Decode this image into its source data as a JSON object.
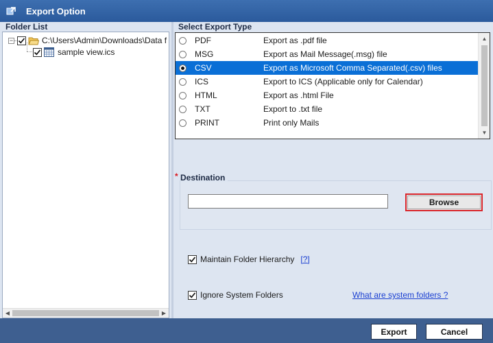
{
  "window": {
    "title": "Export Option"
  },
  "folder_list": {
    "heading": "Folder List",
    "root": {
      "label": "C:\\Users\\Admin\\Downloads\\Data f",
      "checked": true,
      "expander": "−"
    },
    "child": {
      "label": "sample view.ics",
      "checked": true
    }
  },
  "export_type": {
    "heading": "Select Export Type",
    "options": [
      {
        "code": "PDF",
        "desc": "Export as .pdf file",
        "selected": false
      },
      {
        "code": "MSG",
        "desc": "Export as Mail Message(.msg) file",
        "selected": false
      },
      {
        "code": "CSV",
        "desc": "Export as Microsoft Comma Separated(.csv) files",
        "selected": true
      },
      {
        "code": "ICS",
        "desc": "Export to ICS (Applicable only for Calendar)",
        "selected": false
      },
      {
        "code": "HTML",
        "desc": "Export as .html File",
        "selected": false
      },
      {
        "code": "TXT",
        "desc": "Export to .txt file",
        "selected": false
      },
      {
        "code": "PRINT",
        "desc": "Print only Mails",
        "selected": false
      }
    ]
  },
  "destination": {
    "required_mark": "*",
    "label": "Destination",
    "value": "",
    "browse_label": "Browse"
  },
  "options": {
    "maintain_hierarchy": {
      "label": "Maintain Folder Hierarchy",
      "checked": true,
      "help": "[?]"
    },
    "ignore_system": {
      "label": "Ignore System Folders",
      "checked": true,
      "link": "What are system folders ?"
    }
  },
  "footer": {
    "export_label": "Export",
    "cancel_label": "Cancel"
  },
  "colors": {
    "title_bar": "#2b5a9c",
    "selection": "#0a6fd6",
    "footer": "#3e5f90",
    "browse_border": "#d9252b"
  }
}
